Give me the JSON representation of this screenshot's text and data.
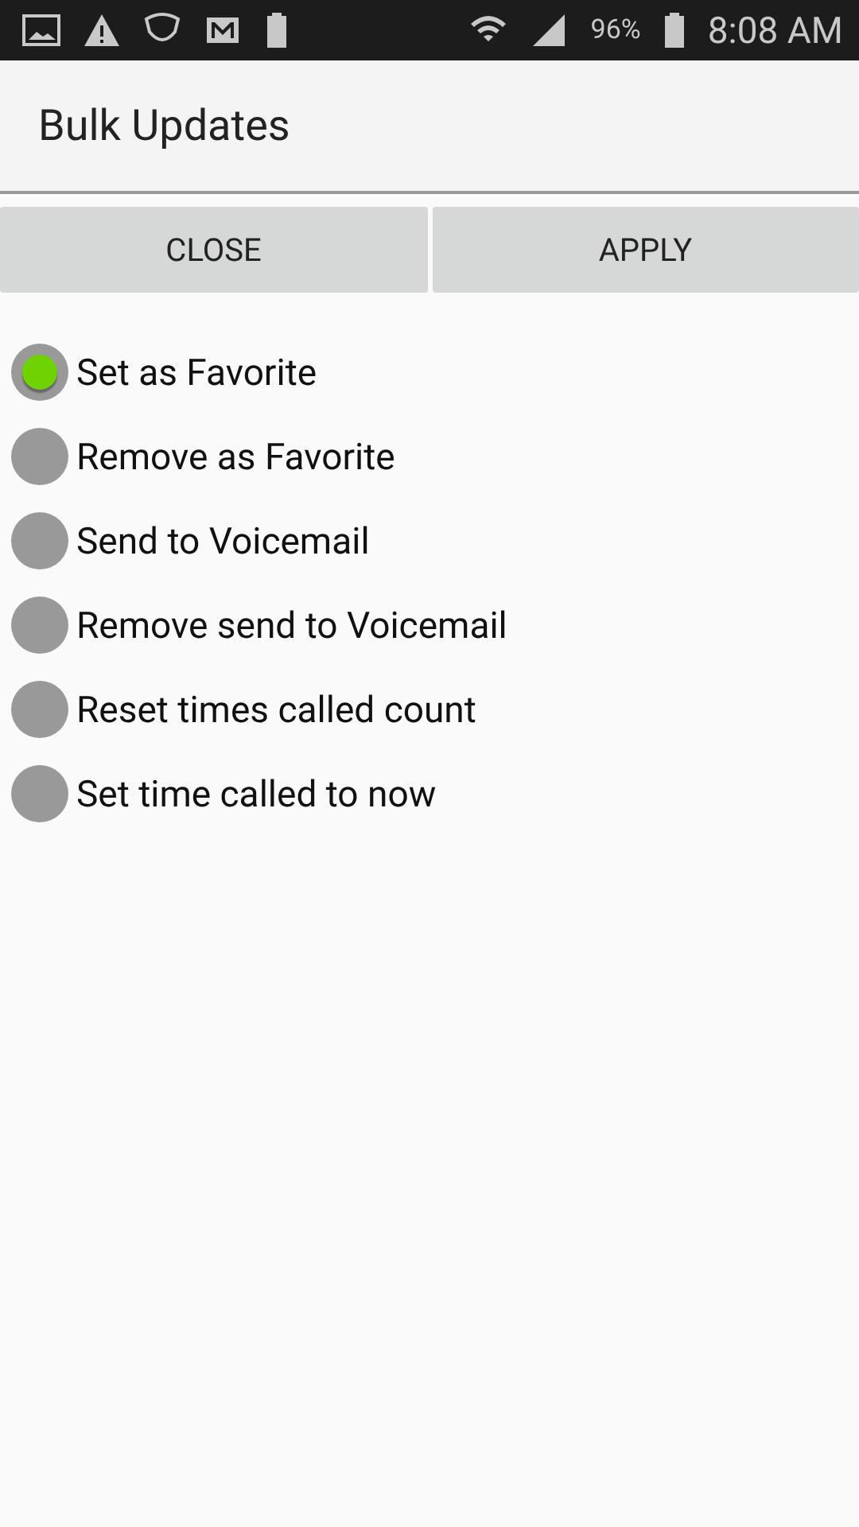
{
  "status_bar": {
    "battery_percent": "96%",
    "time": "8:08 AM"
  },
  "title": "Bulk Updates",
  "buttons": [
    "CLOSE",
    "APPLY"
  ],
  "options": [
    {
      "label": "Set as Favorite",
      "selected": true
    },
    {
      "label": "Remove as Favorite",
      "selected": false
    },
    {
      "label": "Send to Voicemail",
      "selected": false
    },
    {
      "label": "Remove send to Voicemail",
      "selected": false
    },
    {
      "label": "Reset times called count",
      "selected": false
    },
    {
      "label": "Set time called to now",
      "selected": false
    }
  ]
}
